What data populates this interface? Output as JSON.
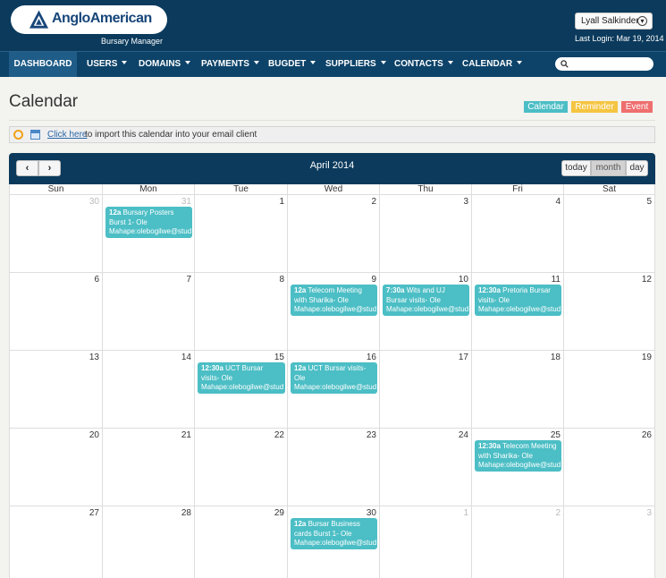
{
  "header": {
    "brand": "AngloAmerican",
    "subtitle": "Bursary Manager",
    "user_name": "Lyall Salkinder",
    "last_login": "Last Login: Mar 19, 2014"
  },
  "nav": {
    "items": [
      {
        "label": "DASHBOARD",
        "dropdown": false,
        "active": true
      },
      {
        "label": "USERS",
        "dropdown": true
      },
      {
        "label": "DOMAINS",
        "dropdown": true
      },
      {
        "label": "PAYMENTS",
        "dropdown": true
      },
      {
        "label": "BUGDET",
        "dropdown": true
      },
      {
        "label": "SUPPLIERS",
        "dropdown": true
      },
      {
        "label": "CONTACTS",
        "dropdown": true
      },
      {
        "label": "CALENDAR",
        "dropdown": true
      }
    ],
    "search_placeholder": "",
    "search_icon": "search-icon"
  },
  "page": {
    "title": "Calendar",
    "legend": [
      {
        "label": "Calendar",
        "color": "#4cbec5"
      },
      {
        "label": "Reminder",
        "color": "#f5c542"
      },
      {
        "label": "Event",
        "color": "#ef6e6e"
      }
    ]
  },
  "import_bar": {
    "link_label": "Click here",
    "text": "to import this calendar into your email client"
  },
  "calendar": {
    "prev_label": "‹",
    "next_label": "›",
    "title": "April 2014",
    "views": [
      "today",
      "month",
      "day"
    ],
    "active_view": "month",
    "weekdays": [
      "Sun",
      "Mon",
      "Tue",
      "Wed",
      "Thu",
      "Fri",
      "Sat"
    ],
    "weeks": [
      [
        {
          "d": "30",
          "other": true
        },
        {
          "d": "31",
          "other": true
        },
        {
          "d": "1"
        },
        {
          "d": "2"
        },
        {
          "d": "3"
        },
        {
          "d": "4"
        },
        {
          "d": "5"
        }
      ],
      [
        {
          "d": "6"
        },
        {
          "d": "7"
        },
        {
          "d": "8"
        },
        {
          "d": "9"
        },
        {
          "d": "10"
        },
        {
          "d": "11"
        },
        {
          "d": "12"
        }
      ],
      [
        {
          "d": "13"
        },
        {
          "d": "14"
        },
        {
          "d": "15"
        },
        {
          "d": "16"
        },
        {
          "d": "17"
        },
        {
          "d": "18"
        },
        {
          "d": "19"
        }
      ],
      [
        {
          "d": "20"
        },
        {
          "d": "21"
        },
        {
          "d": "22"
        },
        {
          "d": "23"
        },
        {
          "d": "24"
        },
        {
          "d": "25"
        },
        {
          "d": "26"
        }
      ],
      [
        {
          "d": "27"
        },
        {
          "d": "28"
        },
        {
          "d": "29"
        },
        {
          "d": "30"
        },
        {
          "d": "1",
          "other": true
        },
        {
          "d": "2",
          "other": true
        },
        {
          "d": "3",
          "other": true
        }
      ]
    ],
    "events": [
      {
        "week": 0,
        "day": 1,
        "time": "12a",
        "text": "Bursary Posters Burst 1- Ole Mahape:olebogilwe@stud"
      },
      {
        "week": 1,
        "day": 3,
        "time": "12a",
        "text": "Telecom Meeting with Sharika- Ole Mahape:olebogilwe@stud"
      },
      {
        "week": 1,
        "day": 4,
        "time": "7:30a",
        "text": "Wits and UJ Bursar visits- Ole Mahape:olebogilwe@stud"
      },
      {
        "week": 1,
        "day": 5,
        "time": "12:30a",
        "text": "Pretoria Bursar visits- Ole Mahape:olebogilwe@stud"
      },
      {
        "week": 2,
        "day": 2,
        "time": "12:30a",
        "text": "UCT Bursar visits- Ole Mahape:olebogilwe@stud"
      },
      {
        "week": 2,
        "day": 3,
        "time": "12a",
        "text": "UCT Bursar visits- Ole Mahape:olebogilwe@stud"
      },
      {
        "week": 3,
        "day": 5,
        "time": "12:30a",
        "text": "Telecom Meeting with Sharika- Ole Mahape:olebogilwe@stud"
      },
      {
        "week": 4,
        "day": 3,
        "time": "12a",
        "text": "Bursar Business cards Burst 1- Ole Mahape:olebogilwe@stud"
      }
    ]
  }
}
